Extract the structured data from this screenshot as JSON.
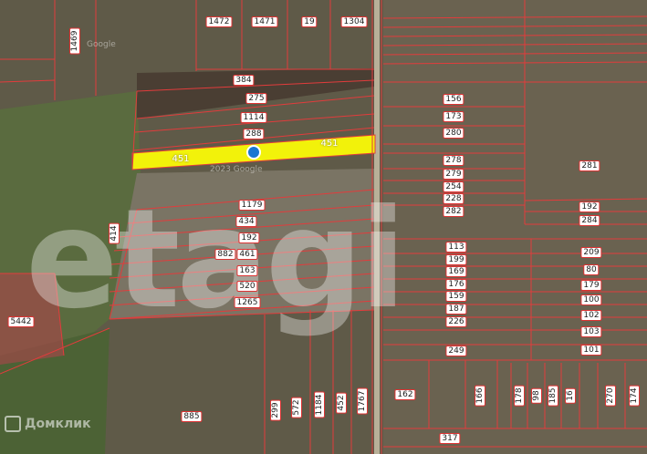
{
  "map": {
    "labels": [
      "1472",
      "1471",
      "19",
      "1304",
      "1469",
      "384",
      "275",
      "1114",
      "288",
      "451",
      "451",
      "156",
      "173",
      "280",
      "278",
      "279",
      "254",
      "228",
      "282",
      "281",
      "192",
      "284",
      "1179",
      "434",
      "192",
      "461",
      "882",
      "163",
      "520",
      "1265",
      "414",
      "113",
      "199",
      "169",
      "176",
      "159",
      "187",
      "226",
      "209",
      "80",
      "179",
      "100",
      "102",
      "103",
      "249",
      "101",
      "5442",
      "885",
      "299",
      "572",
      "1184",
      "452",
      "1767",
      "162",
      "166",
      "178",
      "98",
      "185",
      "16",
      "270",
      "174",
      "317"
    ],
    "selected_parcel": {
      "labels": [
        "451",
        "451"
      ],
      "highlight_color": "#f2f20a"
    },
    "parcel_border_color": "#e23c3c",
    "marker_color": "#1976d2",
    "map_credit": "2023 Google",
    "google_mark": "Google"
  },
  "watermark": {
    "text": "etagi"
  },
  "branding": {
    "text": "Домклик",
    "icon": "domclick-logo-icon"
  }
}
